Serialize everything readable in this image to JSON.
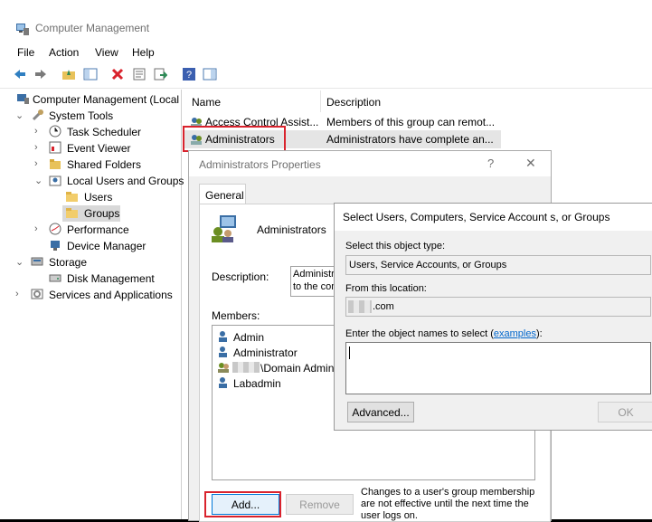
{
  "app": {
    "title": "Computer Management"
  },
  "menu": [
    "File",
    "Action",
    "View",
    "Help"
  ],
  "toolbar": {
    "icons": [
      "back-icon",
      "forward-icon",
      "up-folder-icon",
      "show-hide-tree-icon",
      "delete-icon",
      "properties-icon",
      "export-icon",
      "help-icon",
      "action-pane-icon"
    ]
  },
  "tree": [
    {
      "label": "Computer Management (Local"
    },
    {
      "label": "System Tools"
    },
    {
      "label": "Task Scheduler"
    },
    {
      "label": "Event Viewer"
    },
    {
      "label": "Shared Folders"
    },
    {
      "label": "Local Users and Groups"
    },
    {
      "label": "Users"
    },
    {
      "label": "Groups"
    },
    {
      "label": "Performance"
    },
    {
      "label": "Device Manager"
    },
    {
      "label": "Storage"
    },
    {
      "label": "Disk Management"
    },
    {
      "label": "Services and Applications"
    }
  ],
  "list": {
    "columns": [
      "Name",
      "Description"
    ],
    "rows": [
      {
        "name": "Access Control Assist...",
        "desc": "Members of this group can remot..."
      },
      {
        "name": "Administrators",
        "desc": "Administrators have complete an..."
      }
    ]
  },
  "props": {
    "title": "Administrators Properties",
    "help": "?",
    "close": "✕",
    "tab": "General",
    "group_name": "Administrators",
    "desc_label": "Description:",
    "desc_line1": "Administra",
    "desc_line2": "to the com",
    "members_label": "Members:",
    "members": [
      "Admin",
      "Administrator",
      "\\Domain Admins",
      "Labadmin"
    ],
    "add": "Add...",
    "remove": "Remove",
    "note_line1": "Changes to a user's group membership",
    "note_line2": "are not effective until the next time the",
    "note_line3": "user logs on."
  },
  "select": {
    "title": "Select Users, Computers, Service Account s, or Groups",
    "type_label": "Select this object type:",
    "type_value": "Users, Service Accounts, or Groups",
    "loc_label": "From this location:",
    "loc_value": ".com",
    "names_label": "Enter the object names to select (",
    "examples": "examples",
    "names_label_end": "):",
    "advanced": "Advanced...",
    "ok": "OK"
  }
}
